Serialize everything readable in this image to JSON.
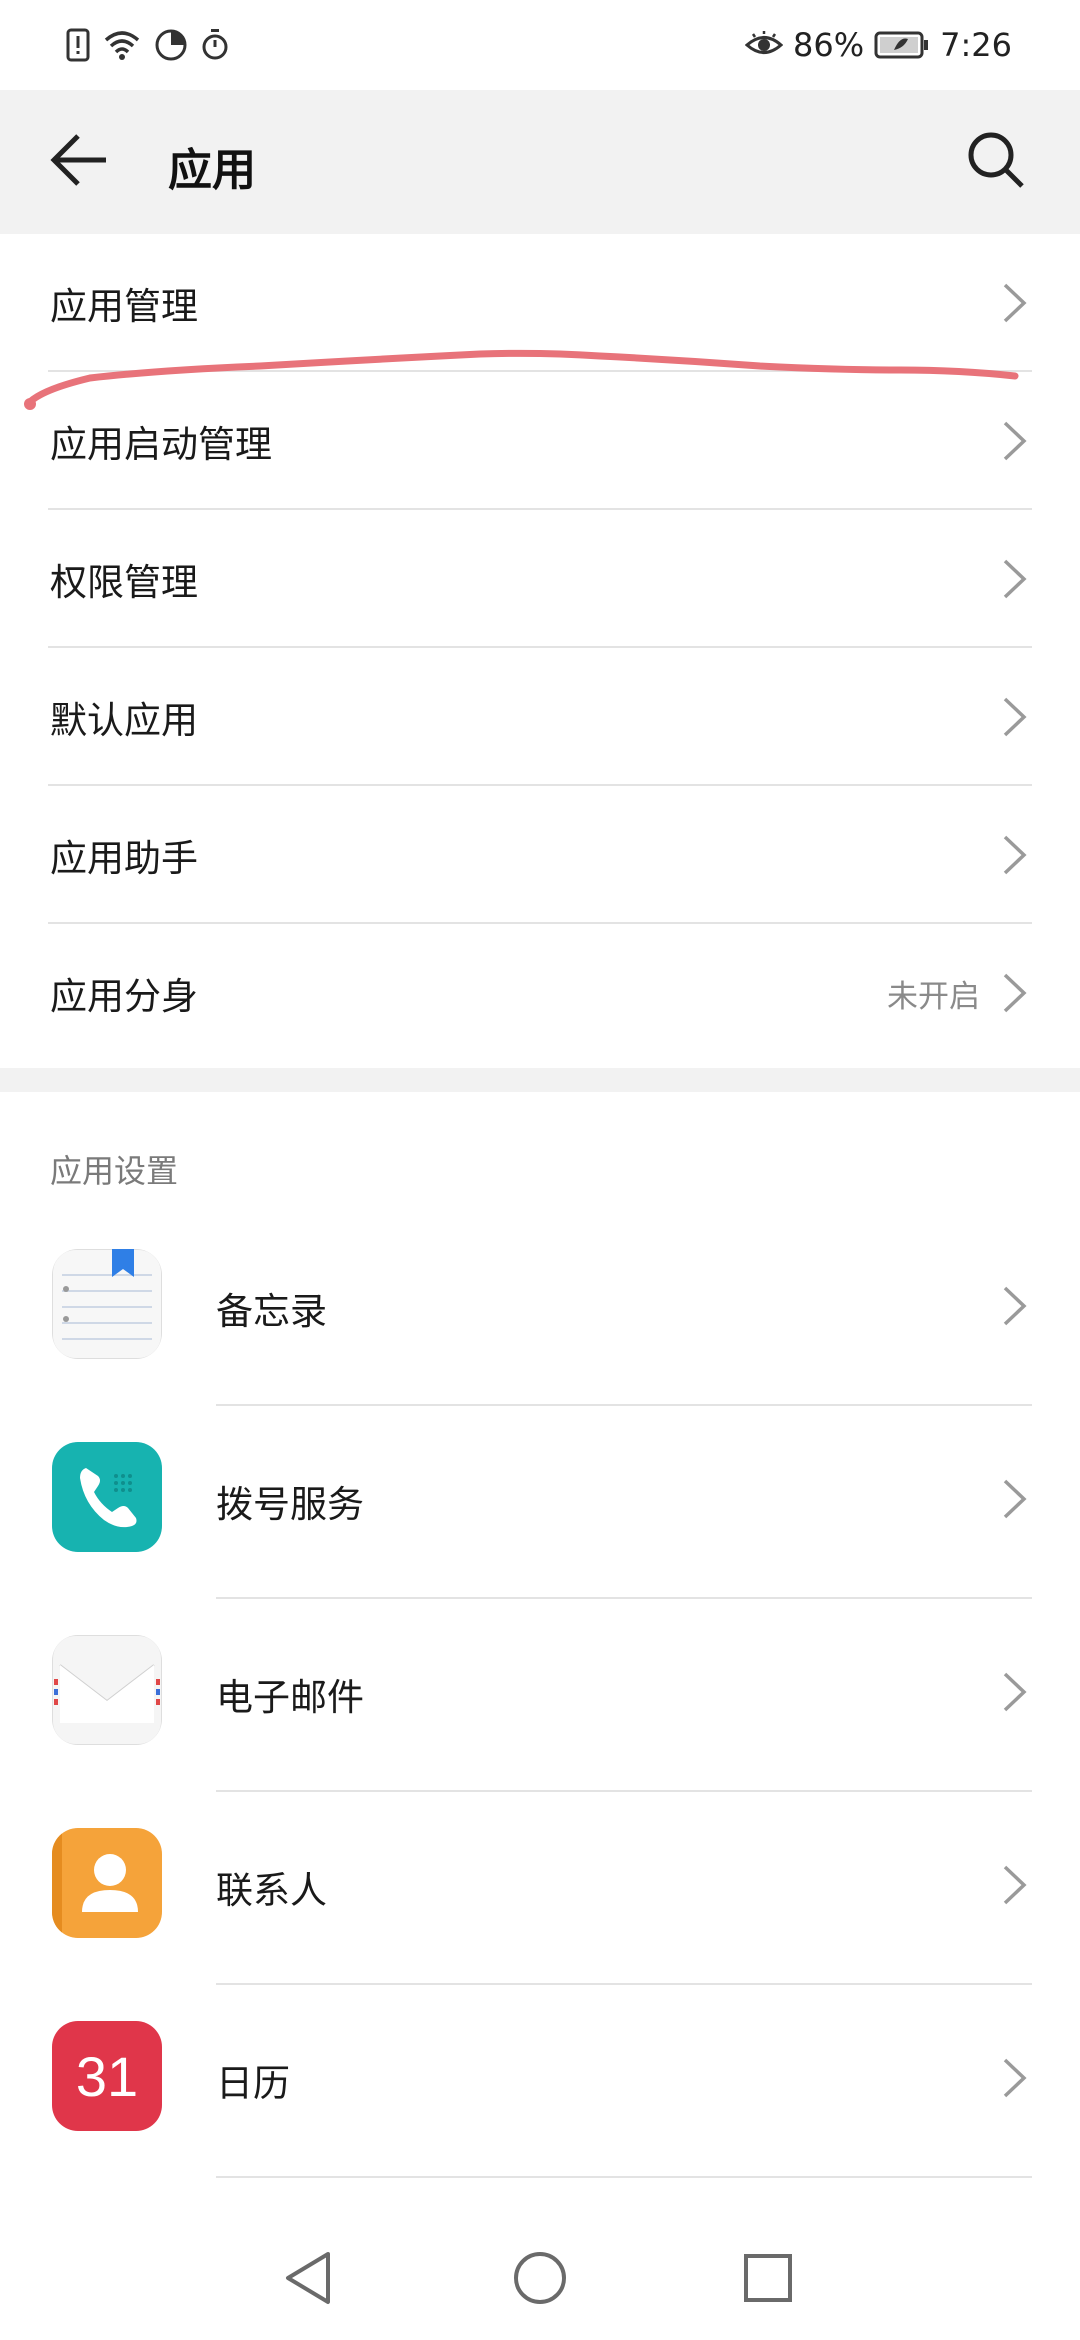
{
  "status_bar": {
    "battery": "86%",
    "time": "7:26",
    "icons": [
      "sim-alert-icon",
      "wifi-icon",
      "data-saver-icon",
      "timer-icon",
      "eye-comfort-icon",
      "battery-icon"
    ]
  },
  "toolbar": {
    "title": "应用",
    "back_icon": "arrow-left-icon",
    "search_icon": "search-icon"
  },
  "menu": {
    "items": [
      {
        "label": "应用管理"
      },
      {
        "label": "应用启动管理"
      },
      {
        "label": "权限管理"
      },
      {
        "label": "默认应用"
      },
      {
        "label": "应用助手"
      },
      {
        "label": "应用分身",
        "value": "未开启"
      }
    ]
  },
  "app_settings": {
    "header": "应用设置",
    "apps": [
      {
        "label": "备忘录",
        "icon": "notepad-icon"
      },
      {
        "label": "拨号服务",
        "icon": "phone-icon"
      },
      {
        "label": "电子邮件",
        "icon": "email-icon"
      },
      {
        "label": "联系人",
        "icon": "contacts-icon"
      },
      {
        "label": "日历",
        "icon": "calendar-icon",
        "icon_text": "31"
      }
    ]
  },
  "colors": {
    "toolbar_bg": "#f2f2f2",
    "annotation": "#e8737a",
    "phone_teal": "#17b3b0",
    "contacts_orange": "#f5a33a",
    "calendar_red": "#e0364a"
  }
}
